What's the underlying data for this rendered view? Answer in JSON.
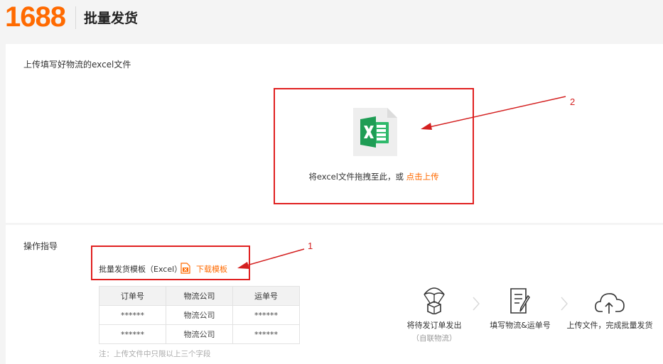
{
  "header": {
    "logo": "1688",
    "title": "批量发货"
  },
  "upload": {
    "label": "上传填写好物流的excel文件",
    "drop_text": "将excel文件拖拽至此，或",
    "drop_link": "点击上传",
    "annotation": "2"
  },
  "guide": {
    "label": "操作指导",
    "template_text": "批量发货模板（Excel）",
    "download_link": "下载模板",
    "annotation": "1",
    "table": {
      "headers": [
        "订单号",
        "物流公司",
        "运单号"
      ],
      "rows": [
        [
          "******",
          "物流公司",
          "******"
        ],
        [
          "******",
          "物流公司",
          "******"
        ]
      ]
    },
    "note": "注：上传文件中只限以上三个字段",
    "steps": [
      {
        "label": "将待发订单发出",
        "sub": "（自联物流）",
        "icon": "parachute-box-icon"
      },
      {
        "label": "填写物流&运单号",
        "icon": "edit-document-icon"
      },
      {
        "label": "上传文件，完成批量发货",
        "icon": "cloud-upload-icon"
      }
    ]
  },
  "colors": {
    "brand": "#ff6a00",
    "annotation": "#e02020",
    "excel": "#1f9d55"
  }
}
